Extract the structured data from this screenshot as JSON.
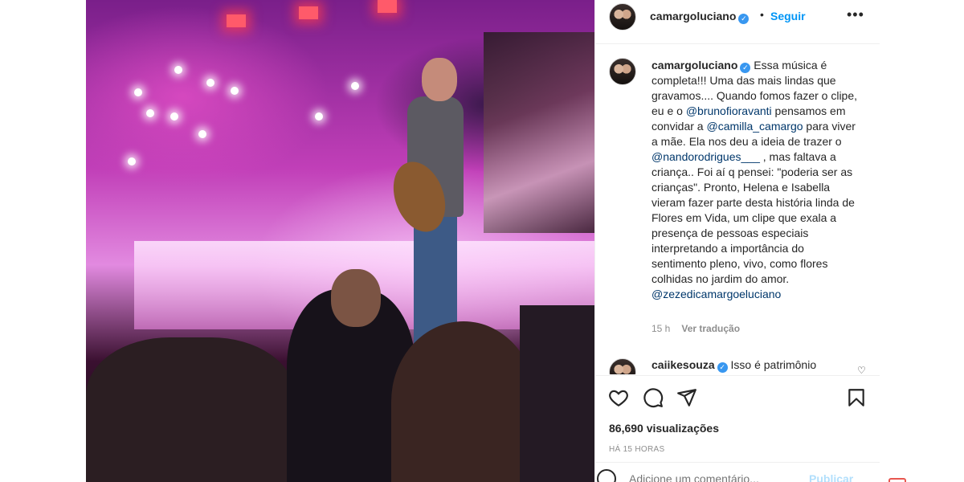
{
  "post": {
    "username": "camargoluciano",
    "verified_icon": "verified-badge-icon",
    "separator": "•",
    "follow_label": "Seguir",
    "more_label": "•••"
  },
  "caption": {
    "username": "camargoluciano",
    "text_1": " Essa música é completa!!! Uma das mais lindas que gravamos.... Quando fomos fazer o clipe, eu e o ",
    "mention_1": "@brunofioravanti",
    "text_2": " pensamos em convidar a ",
    "mention_2": "@camilla_camargo",
    "text_3": " para viver a mãe. Ela nos deu a ideia de trazer o ",
    "mention_3": "@nandorodrigues___",
    "text_4": " , mas faltava a criança.. Foi aí q pensei: \"poderia ser as crianças\". Pronto, Helena e Isabella vieram fazer parte desta história linda de Flores em Vida, um clipe que exala a presença de pessoas especiais interpretando a importância do sentimento pleno, vivo, como flores colhidas no jardim do amor. ",
    "mention_4": "@zezedicamargoeluciano",
    "age": "15 h",
    "translate_label": "Ver tradução"
  },
  "reply": {
    "username": "caiikesouza",
    "text": " Isso é patrimônio"
  },
  "stats": {
    "views": "86,690 visualizações",
    "time": "HÁ 15 HORAS"
  },
  "composer": {
    "placeholder": "Adicione um comentário...",
    "publish_label": "Publicar"
  },
  "icons": [
    "heart-icon",
    "comment-icon",
    "share-icon",
    "bookmark-icon",
    "emoji-icon",
    "more-icon"
  ],
  "colors": {
    "link": "#0095f6",
    "mention": "#00376b",
    "muted": "#8e8e8e",
    "verified": "#3897f0",
    "publish_disabled": "#b2dffc"
  }
}
